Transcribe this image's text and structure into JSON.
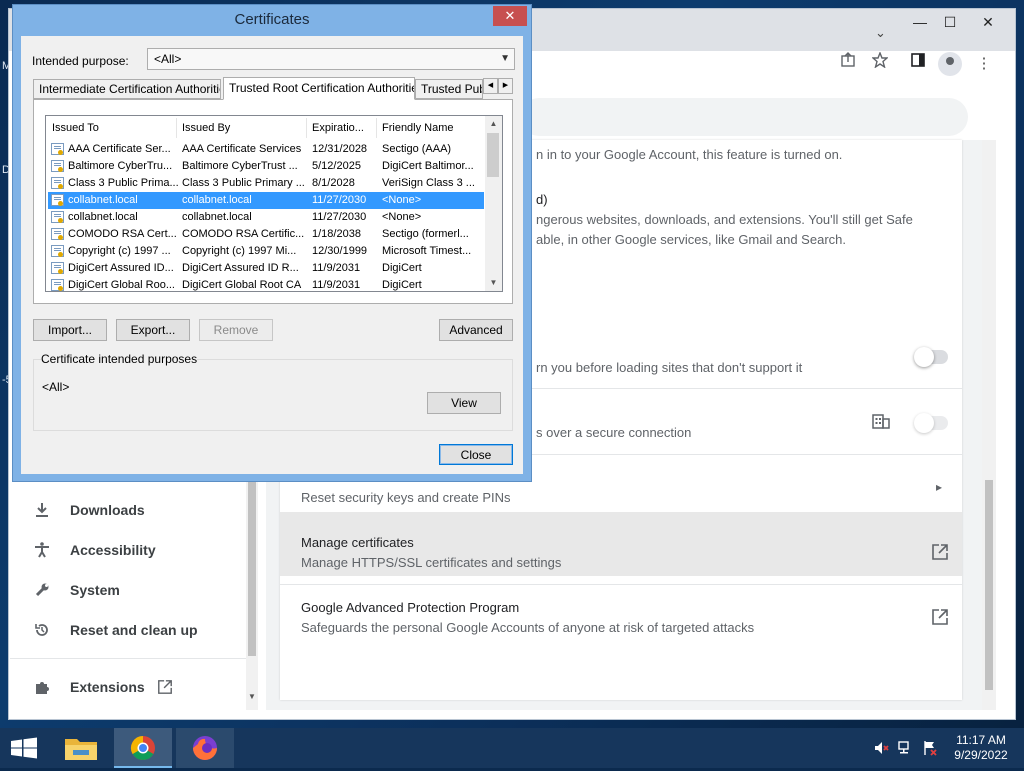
{
  "desktop": {
    "letters": [
      "M",
      "D",
      "-5"
    ]
  },
  "chrome": {
    "window_controls": {
      "minimize": "—",
      "maximize": "☐",
      "close": "✕"
    },
    "tab_dropdown": "⌄",
    "settings": {
      "rows": [
        {
          "sub": "n in to your Google Account, this feature is turned on."
        },
        {
          "title": "d)",
          "sub_line1": "ngerous websites, downloads, and extensions. You'll still get Safe",
          "sub_line2": "able, in other Google services, like Gmail and Search."
        },
        {
          "sub": "rn you before loading sites that don't support it",
          "toggle": "off"
        },
        {
          "sub": "s over a secure connection",
          "toggle": "off-disabled",
          "icon": "building-icon"
        },
        {
          "sub": "Reset security keys and create PINs",
          "chevron": "▸"
        },
        {
          "title": "Manage certificates",
          "sub": "Manage HTTPS/SSL certificates and settings"
        },
        {
          "title": "Google Advanced Protection Program",
          "sub": "Safeguards the personal Google Accounts of anyone at risk of targeted attacks"
        }
      ]
    },
    "sidebar": {
      "items": [
        {
          "label": "Downloads",
          "icon": "download-icon",
          "glyph": "⤓"
        },
        {
          "label": "Accessibility",
          "icon": "accessibility-icon",
          "glyph": "♿"
        },
        {
          "label": "System",
          "icon": "wrench-icon",
          "glyph": "🔧"
        },
        {
          "label": "Reset and clean up",
          "icon": "reset-history-icon",
          "glyph": "↺"
        },
        {
          "label": "Extensions",
          "icon": "puzzle-icon",
          "glyph": "✚"
        }
      ]
    }
  },
  "dialog": {
    "title": "Certificates",
    "close_glyph": "✕",
    "intended_purpose_label": "Intended purpose:",
    "intended_purpose_value": "<All>",
    "tabs": [
      "Intermediate Certification Authorities",
      "Trusted Root Certification Authorities",
      "Trusted Publ"
    ],
    "columns": [
      "Issued To",
      "Issued By",
      "Expiratio...",
      "Friendly Name"
    ],
    "rows": [
      [
        "AAA Certificate Ser...",
        "AAA Certificate Services",
        "12/31/2028",
        "Sectigo (AAA)"
      ],
      [
        "Baltimore CyberTru...",
        "Baltimore CyberTrust ...",
        "5/12/2025",
        "DigiCert Baltimor..."
      ],
      [
        "Class 3 Public Prima...",
        "Class 3 Public Primary ...",
        "8/1/2028",
        "VeriSign Class 3 ..."
      ],
      [
        "collabnet.local",
        "collabnet.local",
        "11/27/2030",
        "<None>"
      ],
      [
        "collabnet.local",
        "collabnet.local",
        "11/27/2030",
        "<None>"
      ],
      [
        "COMODO RSA Cert...",
        "COMODO RSA Certific...",
        "1/18/2038",
        "Sectigo (formerl..."
      ],
      [
        "Copyright (c) 1997 ...",
        "Copyright (c) 1997 Mi...",
        "12/30/1999",
        "Microsoft Timest..."
      ],
      [
        "DigiCert Assured ID...",
        "DigiCert Assured ID R...",
        "11/9/2031",
        "DigiCert"
      ],
      [
        "DigiCert Global Roo...",
        "DigiCert Global Root CA",
        "11/9/2031",
        "DigiCert"
      ]
    ],
    "selected_row": 3,
    "buttons": {
      "import": "Import...",
      "export": "Export...",
      "remove": "Remove",
      "advanced": "Advanced",
      "view": "View",
      "close": "Close"
    },
    "purposes_group_label": "Certificate intended purposes",
    "purposes_value": "<All>"
  },
  "taskbar": {
    "clock_time": "11:17 AM",
    "clock_date": "9/29/2022",
    "apps": [
      "file-explorer",
      "chrome",
      "firefox"
    ]
  },
  "colors": {
    "selection": "#3399ff",
    "dialog_frame": "#7fb2e6",
    "taskbar": "#16365c",
    "close_red": "#c75050"
  }
}
